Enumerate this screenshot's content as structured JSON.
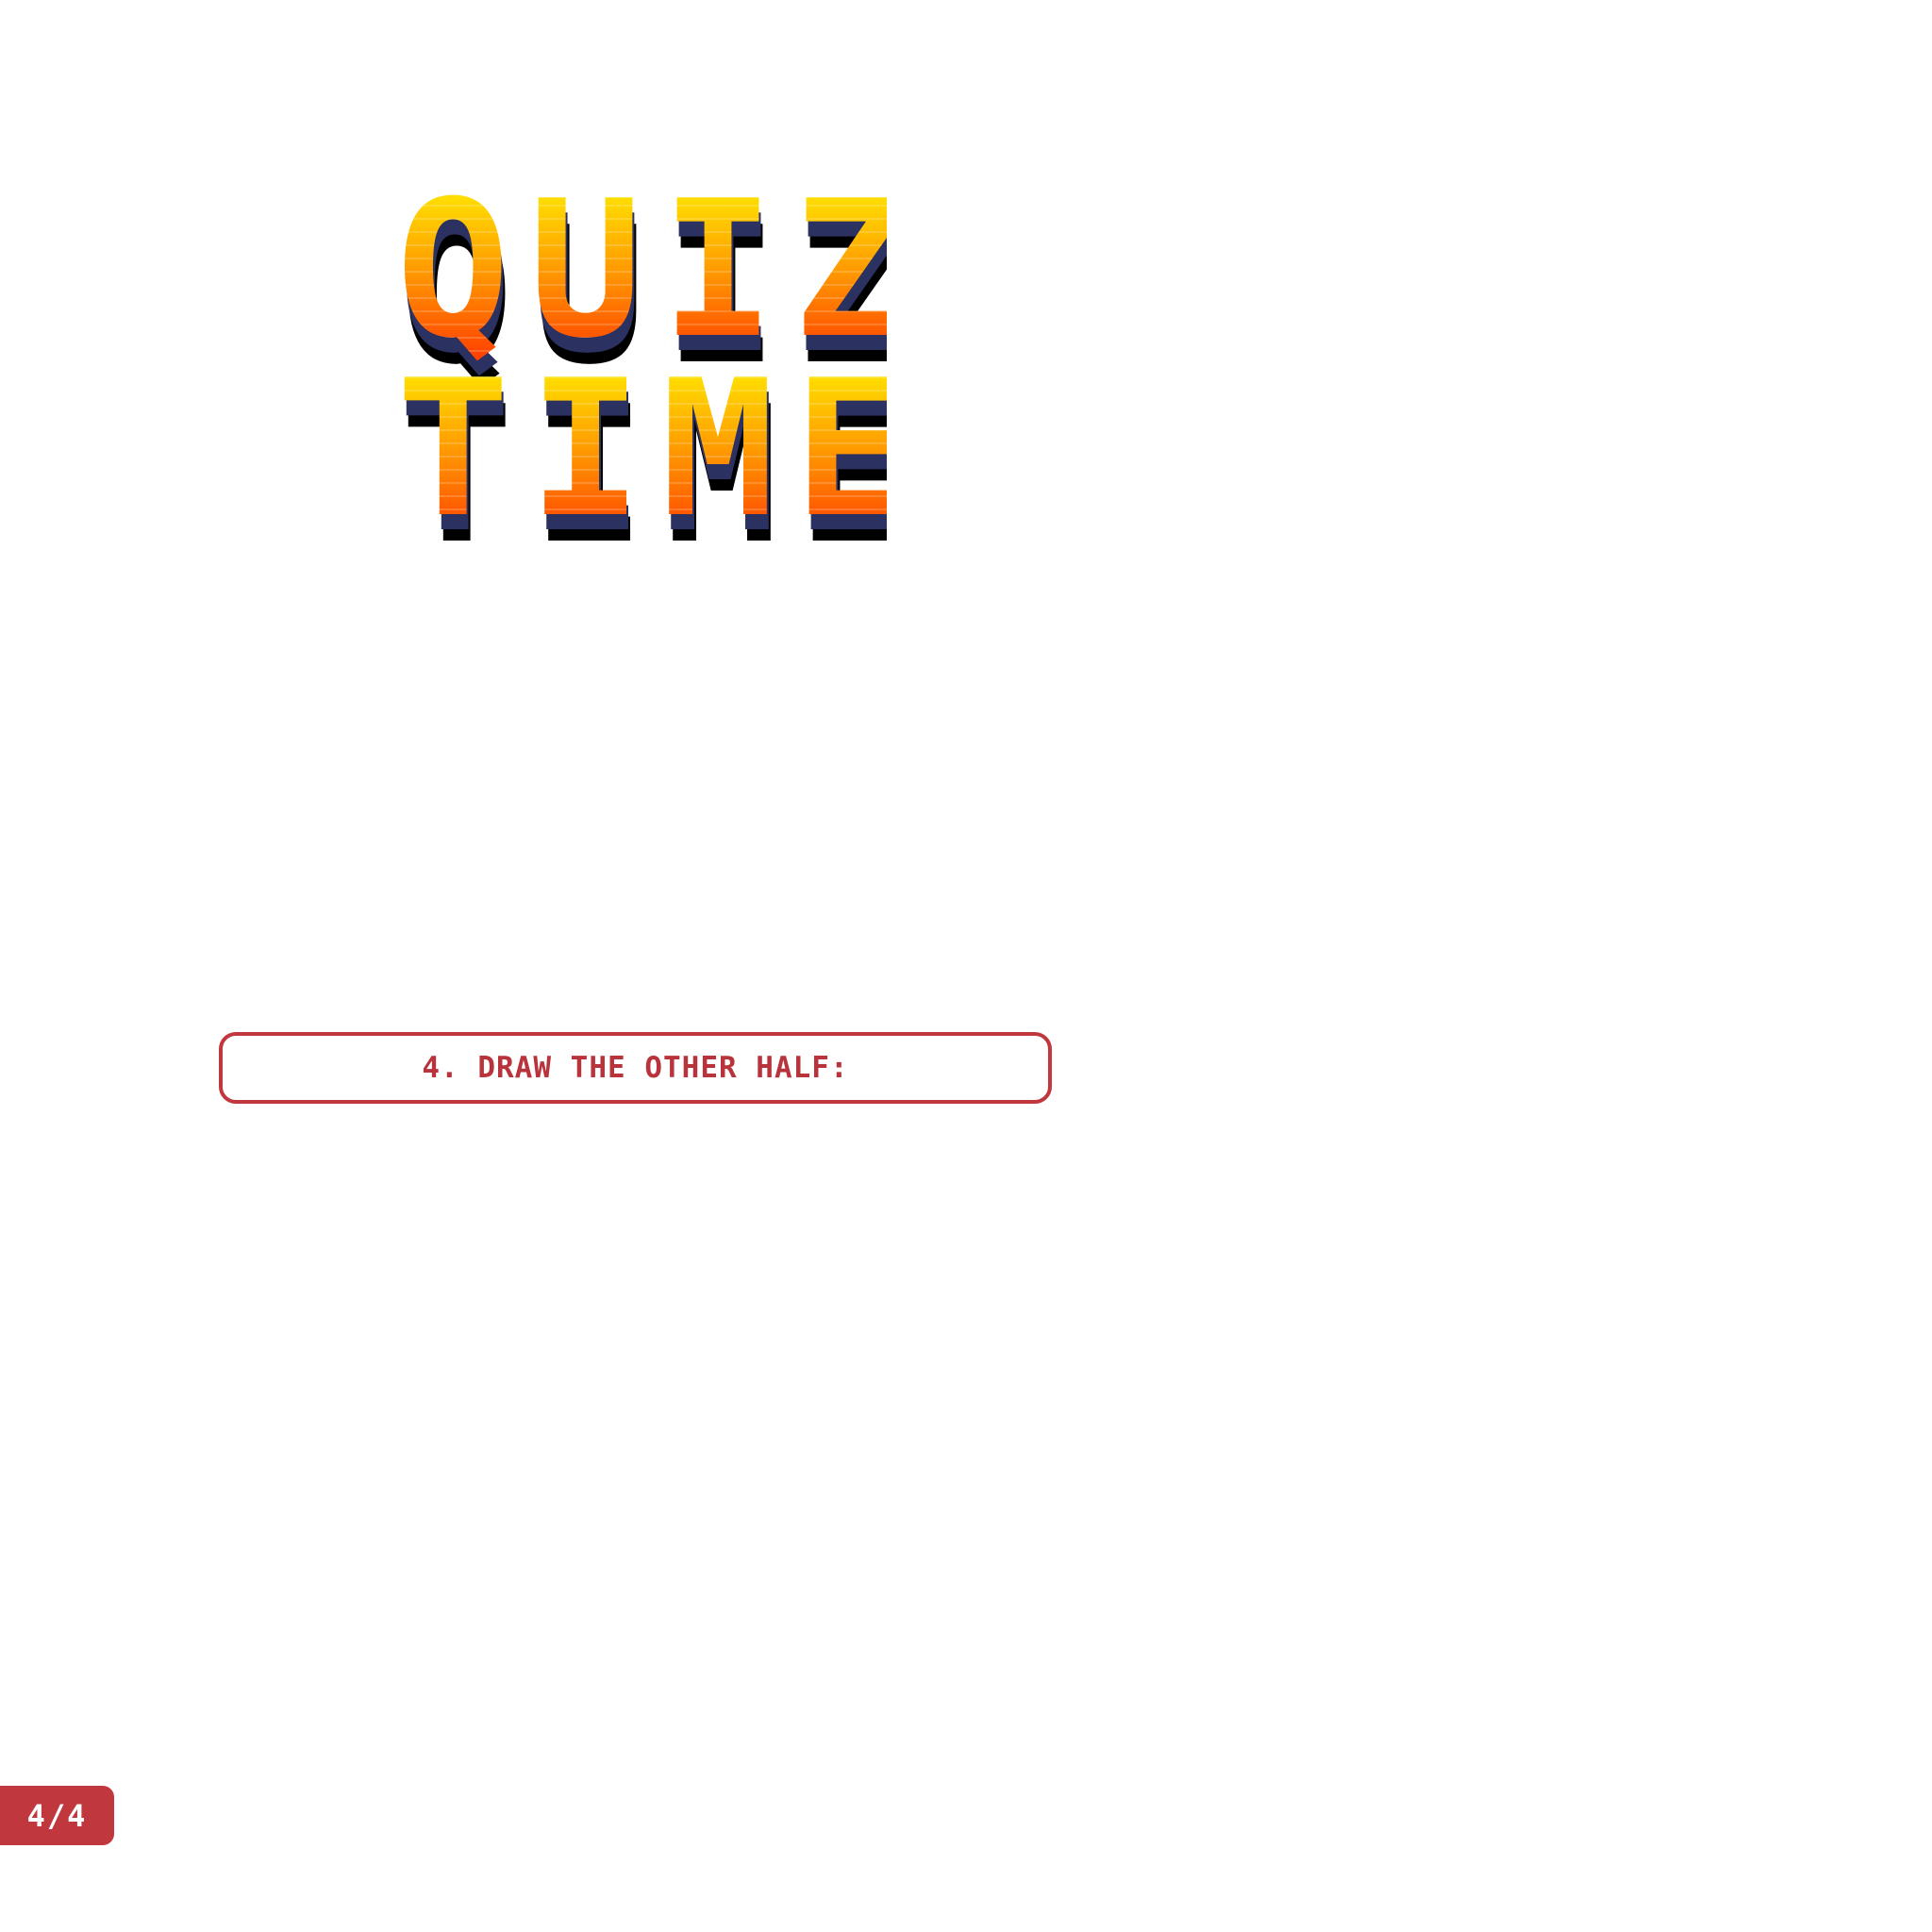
{
  "title": {
    "line1": "QUIZ",
    "line2": "TIME",
    "colors": {
      "gradient_top": "#ffff00",
      "gradient_mid": "#ff9a00",
      "gradient_bottom": "#ff2a00",
      "shadow_navy": "#2b3160",
      "shadow_black": "#000000"
    }
  },
  "question": {
    "text": "4. Draw the other half:",
    "color": "#c1373e"
  },
  "page_indicator": {
    "label": "4/4",
    "color": "#c1373e"
  }
}
